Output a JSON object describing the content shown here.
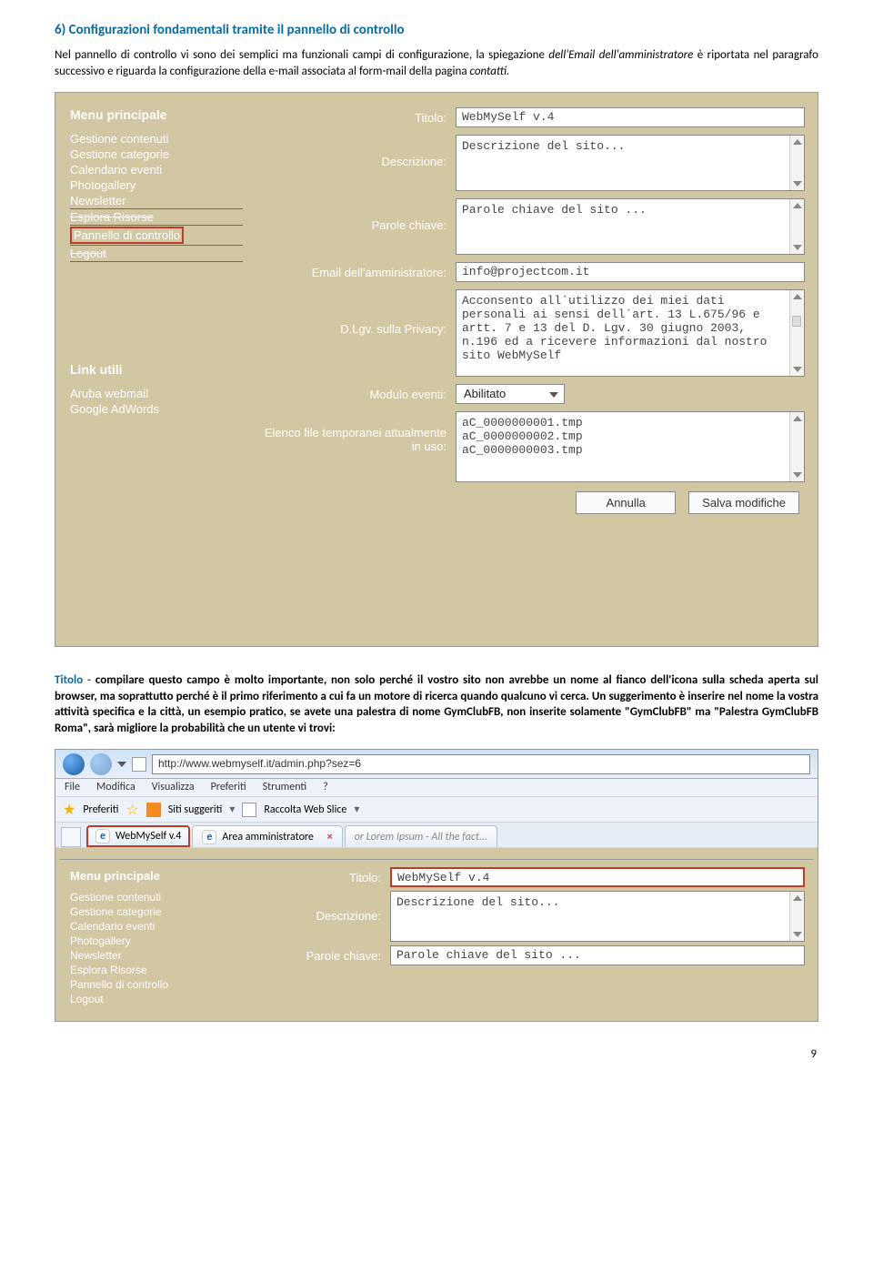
{
  "heading": "6)  Configurazioni fondamentali tramite il pannello di controllo",
  "intro_plain_1": "Nel pannello di controllo vi sono dei semplici ma funzionali campi di configurazione, la spiegazione ",
  "intro_em_1": "dell'Email dell'amministratore",
  "intro_plain_2": " è riportata nel paragrafo successivo e riguarda la configurazione della e-mail associata al form-mail della pagina ",
  "intro_em_2": "contatti.",
  "fig1": {
    "menu_title": "Menu principale",
    "menu": [
      "Gestione contenuti",
      "Gestione categorie",
      "Calendario eventi",
      "Photogallery",
      "Newsletter",
      "Esplora Risorse",
      "Pannello di controllo",
      "Logout"
    ],
    "links_title": "Link utili",
    "links": [
      "Aruba webmail",
      "Google AdWords"
    ],
    "labels": {
      "titolo": "Titolo:",
      "descrizione": "Descrizione:",
      "parole": "Parole chiave:",
      "email": "Email dell'amministratore:",
      "privacy": "D.Lgv. sulla Privacy:",
      "modulo": "Modulo eventi:",
      "elenco": "Elenco file temporanei attualmente in uso:"
    },
    "values": {
      "titolo": "WebMySelf v.4",
      "descrizione": "Descrizione del sito...",
      "parole": "Parole chiave del sito ...",
      "email": "info@projectcom.it",
      "privacy": "Acconsento all`utilizzo dei miei dati personali ai sensi dell`art. 13 L.675/96 e artt. 7 e 13 del D. Lgv. 30 giugno 2003, n.196 ed a ricevere informazioni dal nostro sito WebMySelf",
      "modulo": "Abilitato",
      "elenco": "aC_0000000001.tmp\naC_0000000002.tmp\naC_0000000003.tmp"
    },
    "buttons": {
      "annulla": "Annulla",
      "salva": "Salva modifiche"
    }
  },
  "para2": {
    "lead": "Titolo - ",
    "rest": "compilare questo campo è molto importante, non solo perché il vostro sito non avrebbe un nome al fianco dell'icona sulla scheda aperta sul browser, ma soprattutto perché è il primo riferimento a cui fa un motore di ricerca quando qualcuno vi cerca. Un suggerimento è inserire nel nome la vostra attività specifica e la città, un esempio pratico, se avete una palestra di nome GymClubFB, non inserite solamente \"GymClubFB\" ma \"Palestra GymClubFB Roma\", sarà migliore la probabilità che un utente vi trovi:"
  },
  "fig2": {
    "address": "http://www.webmyself.it/admin.php?sez=6",
    "menubar": [
      "File",
      "Modifica",
      "Visualizza",
      "Preferiti",
      "Strumenti",
      "?"
    ],
    "fav_label": "Preferiti",
    "fav_items": [
      "Siti suggeriti",
      "Raccolta Web Slice"
    ],
    "tabs": [
      {
        "label": "WebMySelf v.4",
        "red": true
      },
      {
        "label": "Area amministratore",
        "x": true
      },
      {
        "label": "or Lorem Ipsum - All the fact...",
        "faded": true
      }
    ],
    "menu_title": "Menu principale",
    "menu": [
      "Gestione contenuti",
      "Gestione categorie",
      "Calendario eventi",
      "Photogallery",
      "Newsletter",
      "Esplora Risorse",
      "Pannello di controllo",
      "Logout"
    ],
    "labels": {
      "titolo": "Titolo:",
      "descrizione": "Descrizione:",
      "parole": "Parole chiave:"
    },
    "values": {
      "titolo": "WebMySelf v.4",
      "descrizione": "Descrizione del sito...",
      "parole": "Parole chiave del sito ..."
    }
  },
  "page_number": "9"
}
